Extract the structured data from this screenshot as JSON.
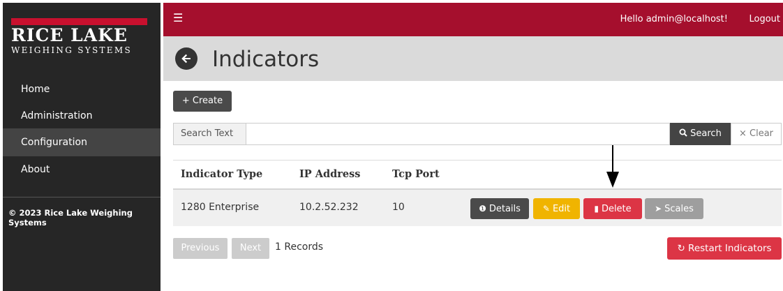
{
  "brand": {
    "name": "RICE LAKE",
    "tagline": "WEIGHING SYSTEMS",
    "red": "#c8102e"
  },
  "header": {
    "menu_icon": "hamburger-icon",
    "greeting": "Hello admin@localhost!",
    "logout_label": "Logout",
    "color": "#a50f2d"
  },
  "sidebar": {
    "items": [
      {
        "label": "Home",
        "active": false
      },
      {
        "label": "Administration",
        "active": false
      },
      {
        "label": "Configuration",
        "active": true
      },
      {
        "label": "About",
        "active": false
      }
    ],
    "copyright": "© 2023 Rice Lake Weighing Systems"
  },
  "page": {
    "title": "Indicators",
    "back_icon": "arrow-left-circle-icon"
  },
  "toolbar": {
    "create_label": "+ Create"
  },
  "search": {
    "label": "Search Text",
    "value": "",
    "search_label": "Search",
    "clear_label": "× Clear"
  },
  "table": {
    "columns": [
      "Indicator Type",
      "IP Address",
      "Tcp Port"
    ],
    "rows": [
      {
        "type": "1280 Enterprise",
        "ip": "10.2.52.232",
        "port": "10",
        "actions": {
          "details": "Details",
          "edit": "Edit",
          "delete": "Delete",
          "scales": "Scales"
        }
      }
    ]
  },
  "pagination": {
    "previous": "Previous",
    "next": "Next",
    "records": "1 Records"
  },
  "restart_label": "Restart Indicators",
  "colors": {
    "edit": "#f0b400",
    "delete": "#dc3545",
    "details": "#4a4a4a",
    "scales": "#9e9e9e"
  }
}
